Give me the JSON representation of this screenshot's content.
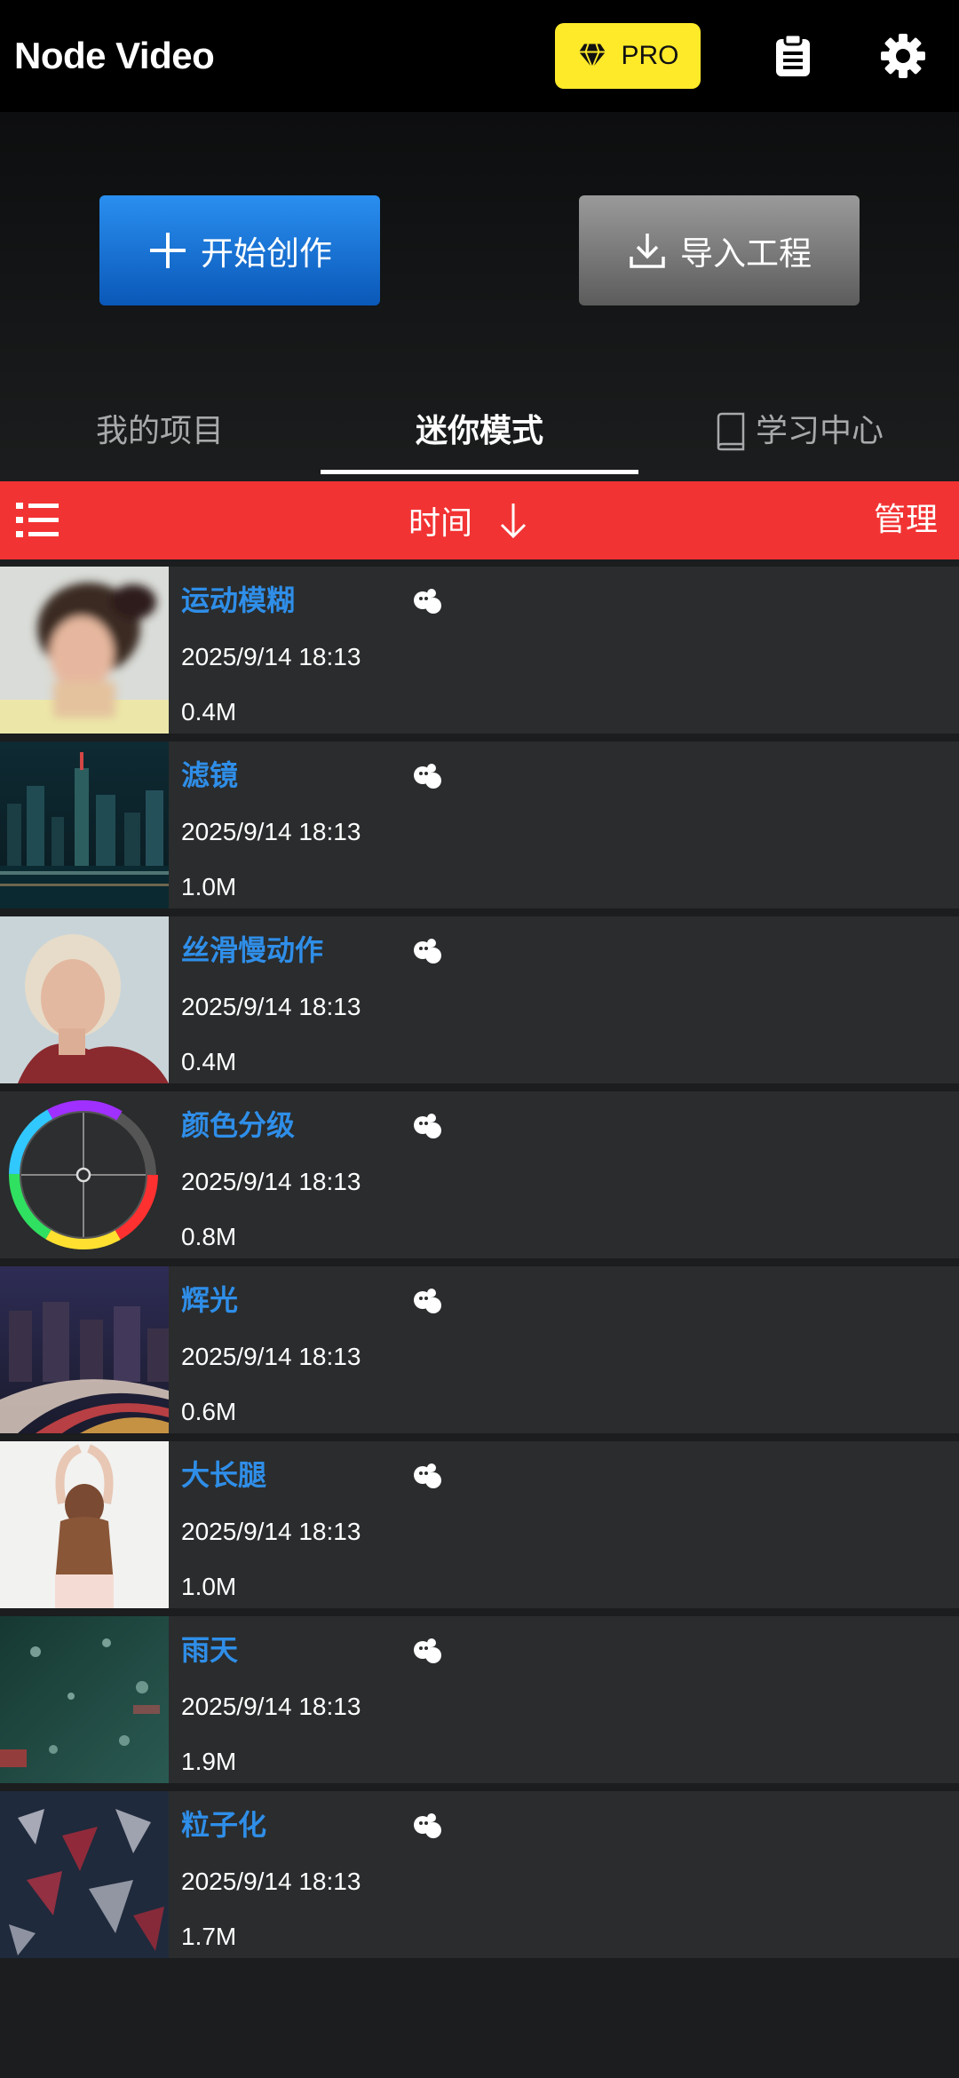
{
  "header": {
    "title": "Node Video",
    "pro_label": "PRO"
  },
  "hero": {
    "create_label": "开始创作",
    "import_label": "导入工程"
  },
  "tabs": [
    {
      "label": "我的项目",
      "active": false
    },
    {
      "label": "迷你模式",
      "active": true
    },
    {
      "label": "学习中心",
      "active": false
    }
  ],
  "sortbar": {
    "sort_label": "时间",
    "manage_label": "管理",
    "color": "#f23333"
  },
  "items": [
    {
      "title": "运动模糊",
      "date": "2025/9/14 18:13",
      "size": "0.4M"
    },
    {
      "title": "滤镜",
      "date": "2025/9/14 18:13",
      "size": "1.0M"
    },
    {
      "title": "丝滑慢动作",
      "date": "2025/9/14 18:13",
      "size": "0.4M"
    },
    {
      "title": "颜色分级",
      "date": "2025/9/14 18:13",
      "size": "0.8M"
    },
    {
      "title": "辉光",
      "date": "2025/9/14 18:13",
      "size": "0.6M"
    },
    {
      "title": "大长腿",
      "date": "2025/9/14 18:13",
      "size": "1.0M"
    },
    {
      "title": "雨天",
      "date": "2025/9/14 18:13",
      "size": "1.9M"
    },
    {
      "title": "粒子化",
      "date": "2025/9/14 18:13",
      "size": "1.7M"
    }
  ],
  "icons": {
    "pro": "diamond-icon",
    "clipboard": "clipboard-icon",
    "settings": "gear-icon",
    "create": "plus-icon",
    "import": "download-icon",
    "learn": "book-icon",
    "list": "list-icon",
    "sort": "arrow-down-icon",
    "item_badge": "mascot-icon"
  },
  "colors": {
    "accent_blue": "#2f8ee8",
    "pro_yellow": "#ffea2a",
    "background": "#1b1d1e",
    "item_background": "#2a2c2d"
  }
}
